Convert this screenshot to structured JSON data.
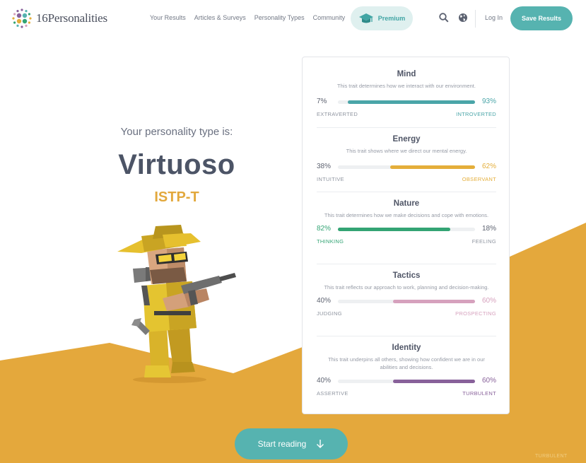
{
  "header": {
    "logo_text": "16Personalities",
    "nav": [
      "Your Results",
      "Articles & Surveys",
      "Personality Types",
      "Community"
    ],
    "premium_label": "Premium",
    "login_label": "Log In",
    "save_label": "Save Results",
    "icons": [
      "search-icon",
      "globe-icon",
      "graduation-cap-icon"
    ]
  },
  "hero": {
    "subtitle": "Your personality type is:",
    "type_name": "Virtuoso",
    "type_code": "ISTP-T"
  },
  "traits": [
    {
      "name": "Mind",
      "description": "This trait determines how we interact with our environment.",
      "left_pct": "7%",
      "right_pct": "93%",
      "left_label": "EXTRAVERTED",
      "right_label": "INTROVERTED",
      "dominant": "right",
      "dominant_value": 0.93,
      "color": "#4aa5a8"
    },
    {
      "name": "Energy",
      "description": "This trait shows where we direct our mental energy.",
      "left_pct": "38%",
      "right_pct": "62%",
      "left_label": "INTUITIVE",
      "right_label": "OBSERVANT",
      "dominant": "right",
      "dominant_value": 0.62,
      "color": "#e4ae3a"
    },
    {
      "name": "Nature",
      "description": "This trait determines how we make decisions and cope with emotions.",
      "left_pct": "82%",
      "right_pct": "18%",
      "left_label": "THINKING",
      "right_label": "FEELING",
      "dominant": "left",
      "dominant_value": 0.82,
      "color": "#33a474"
    },
    {
      "name": "Tactics",
      "description": "This trait reflects our approach to work, planning and decision-making.",
      "left_pct": "40%",
      "right_pct": "60%",
      "left_label": "JUDGING",
      "right_label": "PROSPECTING",
      "dominant": "right",
      "dominant_value": 0.6,
      "color": "#d6a1bd"
    },
    {
      "name": "Identity",
      "description": "This trait underpins all others, showing how confident we are in our abilities and decisions.",
      "left_pct": "40%",
      "right_pct": "60%",
      "left_label": "ASSERTIVE",
      "right_label": "TURBULENT",
      "dominant": "right",
      "dominant_value": 0.6,
      "color": "#88619a"
    }
  ],
  "cta": {
    "start_label": "Start reading"
  },
  "ghost_text": "TURBULENT",
  "colors": {
    "accent_teal": "#56b3b0",
    "mustard": "#e4a83c",
    "premium_bg": "#dff0ef"
  }
}
